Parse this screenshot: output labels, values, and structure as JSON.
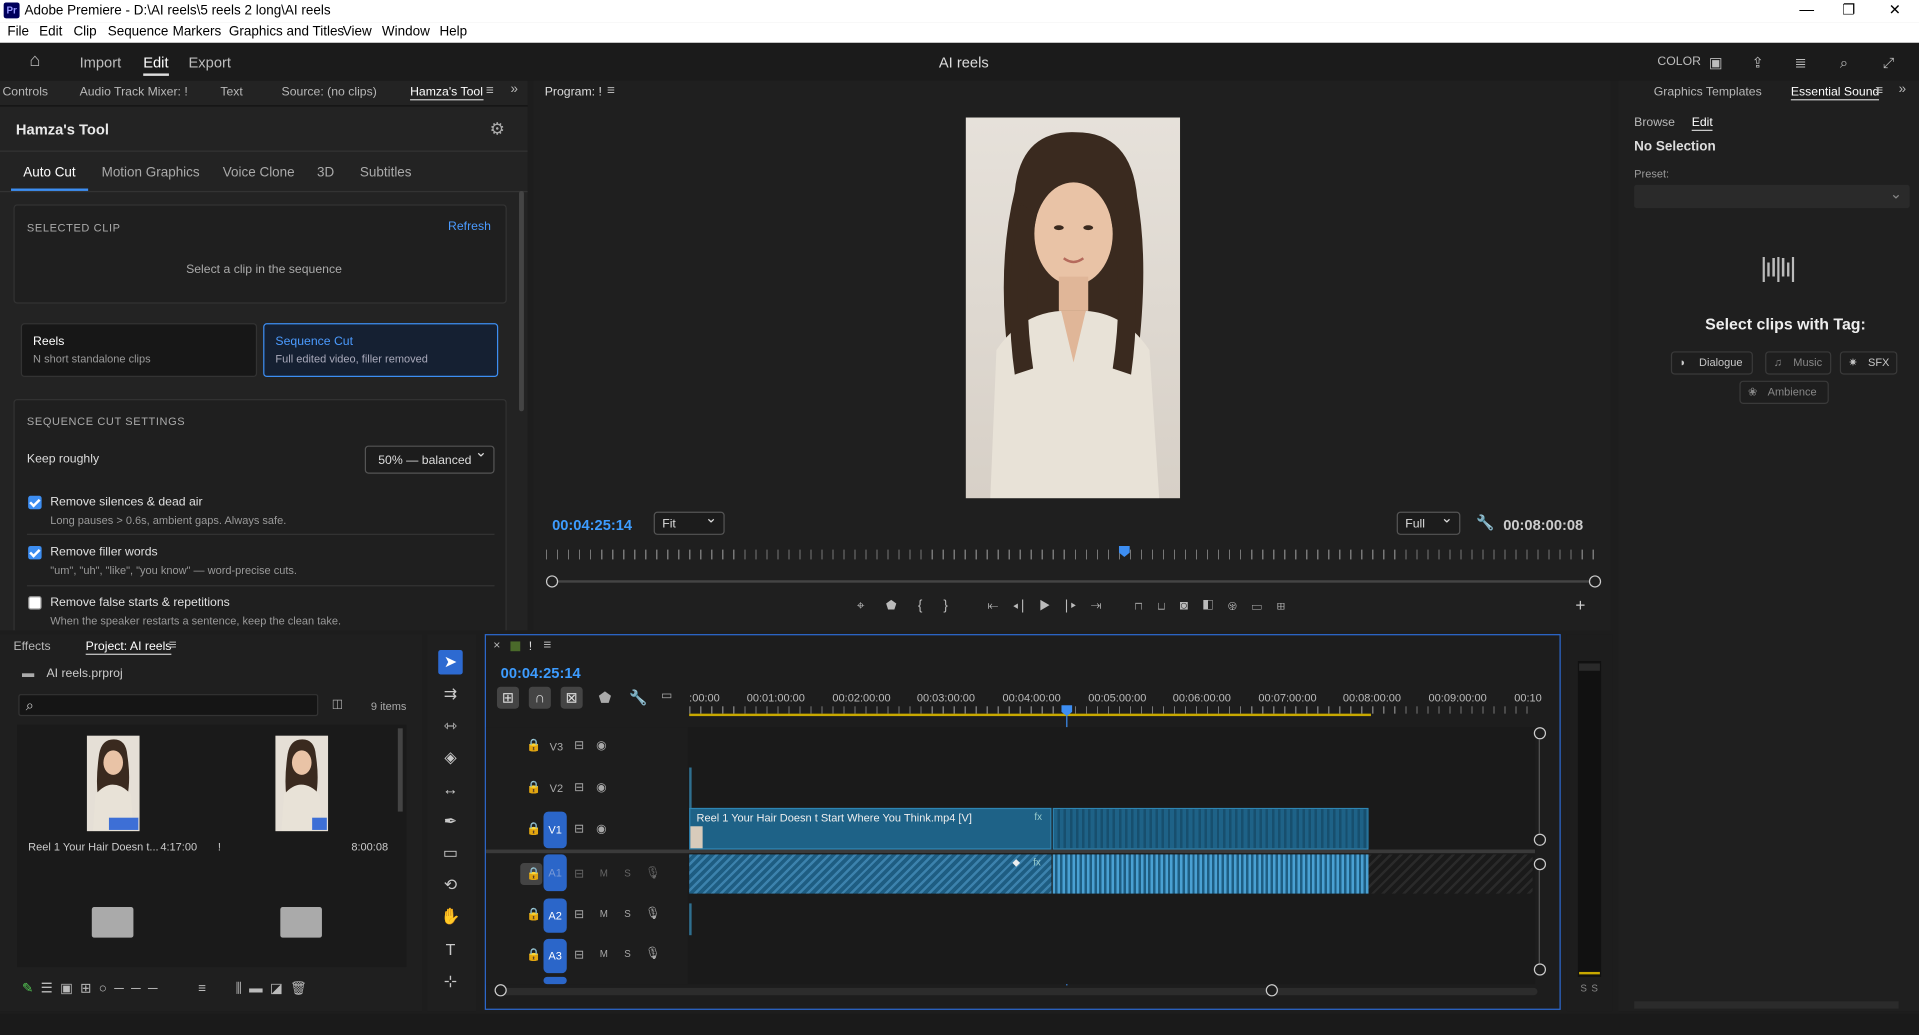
{
  "app": {
    "icon": "Pr",
    "title": "Adobe Premiere - D:\\AI reels\\5 reels 2 long\\AI reels"
  },
  "menu": [
    "File",
    "Edit",
    "Clip",
    "Sequence",
    "Markers",
    "Graphics and Titles",
    "View",
    "Window",
    "Help"
  ],
  "header": {
    "import": "Import",
    "edit": "Edit",
    "export": "Export",
    "project_title": "AI reels",
    "color": "COLOR"
  },
  "left_tabs": [
    "Controls",
    "Audio Track Mixer: !",
    "Text",
    "Source: (no clips)",
    "Hamza's Tool"
  ],
  "tool": {
    "title": "Hamza's Tool",
    "tabs": [
      "Auto Cut",
      "Motion Graphics",
      "Voice Clone",
      "3D",
      "Subtitles"
    ],
    "selected_clip_heading": "SELECTED CLIP",
    "refresh": "Refresh",
    "select_hint": "Select a clip in the sequence",
    "mode_reels_title": "Reels",
    "mode_reels_sub": "N short standalone clips",
    "mode_seq_title": "Sequence Cut",
    "mode_seq_sub": "Full edited video, filler removed",
    "settings_heading": "SEQUENCE CUT SETTINGS",
    "keep_label": "Keep roughly",
    "keep_value": "50% — balanced",
    "opt1_title": "Remove silences & dead air",
    "opt1_sub": "Long pauses > 0.6s, ambient gaps. Always safe.",
    "opt1_checked": true,
    "opt2_title": "Remove filler words",
    "opt2_sub": "\"um\", \"uh\", \"like\", \"you know\" — word-precise cuts.",
    "opt2_checked": true,
    "opt3_title": "Remove false starts & repetitions",
    "opt3_sub": "When the speaker restarts a sentence, keep the clean take.",
    "opt3_checked": false
  },
  "program": {
    "tab": "Program: !",
    "timecode": "00:04:25:14",
    "fit": "Fit",
    "full": "Full",
    "duration": "00:08:00:08"
  },
  "right": {
    "tab1": "Graphics Templates",
    "tab2": "Essential Sound",
    "browse": "Browse",
    "edit": "Edit",
    "no_selection": "No Selection",
    "preset": "Preset:",
    "select_tag": "Select clips with Tag:",
    "tags": [
      "Dialogue",
      "Music",
      "SFX",
      "Ambience"
    ]
  },
  "project": {
    "tab1": "Effects",
    "tab2": "Project: AI reels",
    "file": "AI reels.prproj",
    "items": "9 items",
    "item1_name": "Reel 1 Your Hair Doesn t...",
    "item1_dur": "4:17:00",
    "item1_flag": "!",
    "item2_dur": "8:00:08"
  },
  "timeline": {
    "tab": "!",
    "timecode": "00:04:25:14",
    "ruler": [
      ":00:00",
      "00:01:00:00",
      "00:02:00:00",
      "00:03:00:00",
      "00:04:00:00",
      "00:05:00:00",
      "00:06:00:00",
      "00:07:00:00",
      "00:08:00:00",
      "00:09:00:00",
      "00:10"
    ],
    "tracks": [
      "V3",
      "V2",
      "V1",
      "A1",
      "A2",
      "A3"
    ],
    "clip_name": "Reel 1 Your Hair Doesn t Start Where You Think.mp4 [V]",
    "m": "M",
    "s": "S"
  },
  "meter": {
    "s1": "S",
    "s2": "S"
  }
}
